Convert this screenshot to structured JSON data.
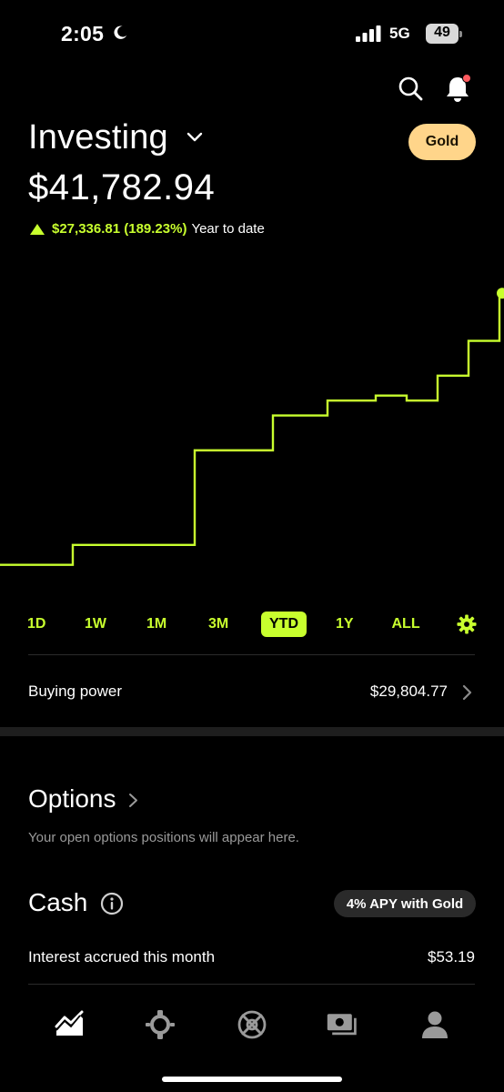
{
  "status_bar": {
    "time": "2:05",
    "network": "5G",
    "battery": "49"
  },
  "header": {
    "title": "Investing",
    "gold_label": "Gold",
    "balance": "$41,782.94",
    "change_value": "$27,336.81 (189.23%)",
    "change_period": "Year to date"
  },
  "colors": {
    "accent": "#c8ff2e",
    "gold": "#ffd58a",
    "background": "#000000"
  },
  "chart_data": {
    "type": "line",
    "title": "",
    "xlabel": "",
    "ylabel": "",
    "x": [
      0,
      1,
      2,
      3,
      4,
      5,
      6,
      7,
      8,
      9,
      10,
      11,
      12,
      13,
      14,
      15,
      16
    ],
    "series": [
      {
        "values": [
          14500,
          14500,
          16500,
          16500,
          26000,
          26000,
          29500,
          31000,
          31500,
          31500,
          31500,
          31000,
          33500,
          35000,
          37000,
          39000,
          41783
        ]
      }
    ]
  },
  "time_ranges": [
    "1D",
    "1W",
    "1M",
    "3M",
    "YTD",
    "1Y",
    "ALL"
  ],
  "active_range": "YTD",
  "buying_power": {
    "label": "Buying power",
    "value": "$29,804.77"
  },
  "options": {
    "title": "Options",
    "subtitle": "Your open options positions will appear here."
  },
  "cash": {
    "title": "Cash",
    "apy_badge": "4% APY with Gold",
    "interest_label": "Interest accrued this month",
    "interest_value": "$53.19"
  },
  "tab_bar": {
    "icons": [
      "chart-icon",
      "browse-icon",
      "crypto-icon",
      "cash-icon",
      "account-icon"
    ]
  }
}
